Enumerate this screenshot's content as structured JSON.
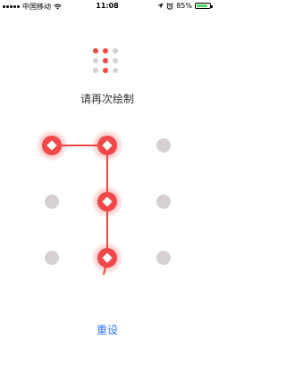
{
  "status_bar": {
    "carrier": "中国移动",
    "time": "11:08",
    "battery_percent": "85%",
    "battery_color": "#4cd964",
    "icons": [
      "signal-dots-icon",
      "wifi-icon",
      "location-arrow-icon",
      "alarm-icon",
      "battery-icon"
    ]
  },
  "preview": {
    "active": [
      true,
      true,
      false,
      false,
      true,
      false,
      false,
      true,
      false
    ]
  },
  "prompt": "请再次绘制",
  "pattern": {
    "path": [
      0,
      1,
      4,
      7
    ],
    "accent_color": "#f04848",
    "inactive_color": "#d6d0d2"
  },
  "reset_label": "重设"
}
